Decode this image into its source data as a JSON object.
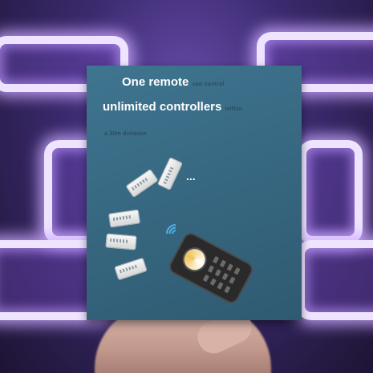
{
  "headline": {
    "line1_bold": "One remote",
    "line1_small": "can control",
    "line2_bold": "unlimited controllers",
    "line2_small": "within",
    "line3_small": "a 30m distance"
  },
  "ellipsis": "...",
  "colors": {
    "card_background": "#3a6d87",
    "small_text": "#2a4d62",
    "wifi_symbol": "#4fb3e8",
    "neon_glow": "#efe4ff"
  },
  "icons": [
    "controller-device-icon",
    "wifi-signal-icon",
    "remote-control-icon"
  ]
}
